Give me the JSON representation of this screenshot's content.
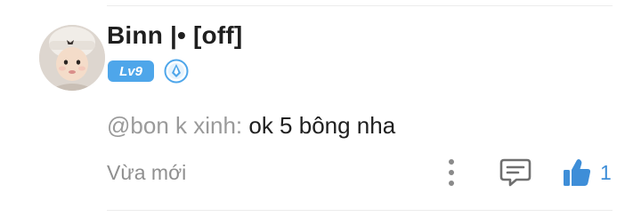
{
  "comment": {
    "username": "Binn |• [off]",
    "level_badge": "Lv9",
    "mention": "@bon k xinh:",
    "text": " ok 5 bông nha",
    "timestamp": "Vừa mới",
    "like_count": "1"
  },
  "icons": {
    "avatar": "profile-photo",
    "verified": "verified-badge-icon",
    "more": "more-vertical-icon",
    "reply": "comment-icon",
    "like": "thumbs-up-icon"
  },
  "colors": {
    "accent": "#4ea6ea",
    "like": "#3e8ed8",
    "muted_text": "#8f8f8f",
    "mention_text": "#9a9a9a",
    "primary_text": "#1f1f1f"
  }
}
